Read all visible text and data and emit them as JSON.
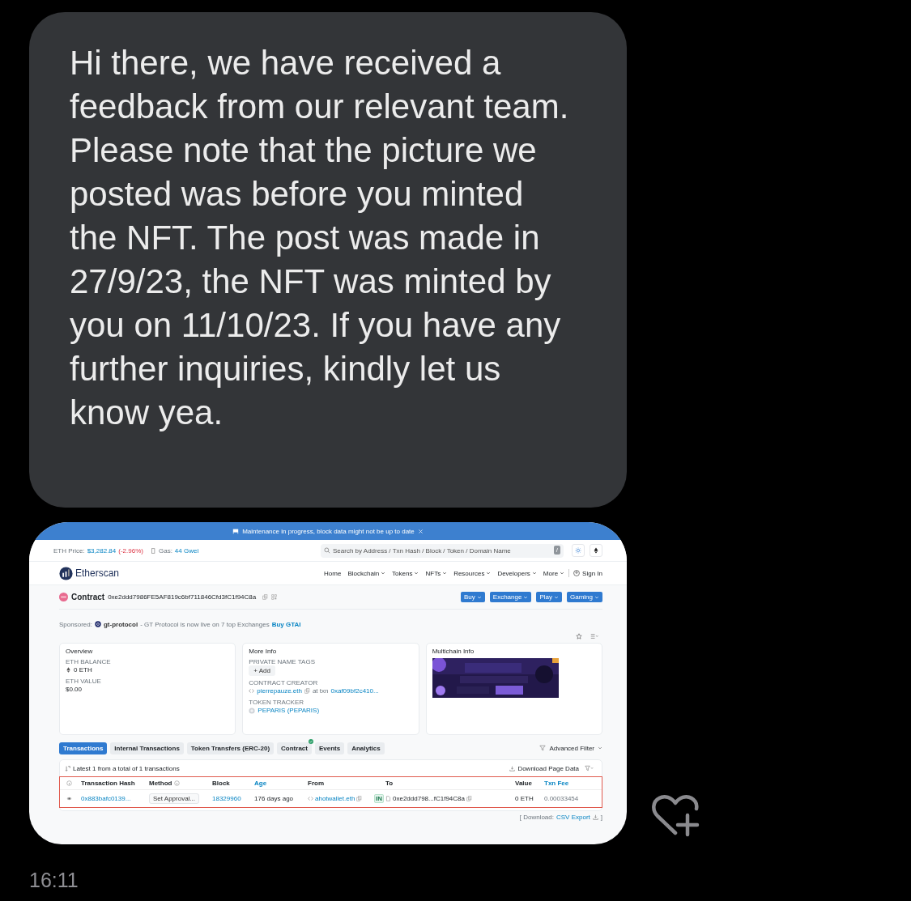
{
  "message": {
    "text": "Hi there, we have received a feedback from our relevant team. Please note that the picture we posted was before you minted the NFT. The post was made in 27/9/23, the NFT was minted by you on 11/10/23. If you have any further inquiries, kindly let us know yea."
  },
  "attachment": {
    "banner": {
      "text": "Maintenance in progress, block data might not be up to date"
    },
    "topbar": {
      "eth_price_label": "ETH Price:",
      "eth_price": "$3,282.84",
      "eth_change": "(-2.96%)",
      "gas_label": "Gas:",
      "gas": "44 Gwei",
      "search_placeholder": "Search by Address / Txn Hash / Block / Token / Domain Name",
      "shortcut": "/"
    },
    "nav": {
      "brand": "Etherscan",
      "items": [
        {
          "label": "Home",
          "dropdown": false
        },
        {
          "label": "Blockchain",
          "dropdown": true
        },
        {
          "label": "Tokens",
          "dropdown": true
        },
        {
          "label": "NFTs",
          "dropdown": true
        },
        {
          "label": "Resources",
          "dropdown": true
        },
        {
          "label": "Developers",
          "dropdown": true
        },
        {
          "label": "More",
          "dropdown": true
        }
      ],
      "sign_in": "Sign In"
    },
    "contract": {
      "label": "Contract",
      "address": "0xe2ddd7986FE5AF819c6bf711846Cfd3fC1f94C8a",
      "buttons": [
        "Buy",
        "Exchange",
        "Play",
        "Gaming"
      ]
    },
    "sponsored": {
      "label": "Sponsored:",
      "name": "gt-protocol",
      "text": "- GT Protocol is now live on 7 top Exchanges",
      "link": "Buy GTAI"
    },
    "overview": {
      "title": "Overview",
      "fields": [
        {
          "label": "ETH BALANCE",
          "value": "0 ETH",
          "eth": true
        },
        {
          "label": "ETH VALUE",
          "value": "$0.00",
          "eth": false
        }
      ]
    },
    "more_info": {
      "title": "More Info",
      "name_tags_label": "PRIVATE NAME TAGS",
      "add": "+ Add",
      "creator_label": "CONTRACT CREATOR",
      "creator": "pierrepauze.eth",
      "at_txn": "at txn",
      "txn": "0xaf09bf2c410...",
      "tracker_label": "TOKEN TRACKER",
      "token": "PEPARIS (PEPARIS)"
    },
    "multichain": {
      "title": "Multichain Info"
    },
    "tabs": [
      {
        "label": "Transactions",
        "selected": true,
        "verified": false
      },
      {
        "label": "Internal Transactions",
        "selected": false,
        "verified": false
      },
      {
        "label": "Token Transfers (ERC-20)",
        "selected": false,
        "verified": false
      },
      {
        "label": "Contract",
        "selected": false,
        "verified": true
      },
      {
        "label": "Events",
        "selected": false,
        "verified": false
      },
      {
        "label": "Analytics",
        "selected": false,
        "verified": false
      }
    ],
    "advanced_filter": "Advanced Filter",
    "table": {
      "summary": "Latest 1 from a total of 1 transactions",
      "download": "Download Page Data",
      "columns": [
        {
          "label": "Transaction Hash",
          "link": false,
          "info": false
        },
        {
          "label": "Method",
          "link": false,
          "info": true
        },
        {
          "label": "Block",
          "link": false,
          "info": false
        },
        {
          "label": "Age",
          "link": true,
          "info": false
        },
        {
          "label": "From",
          "link": false,
          "info": false
        },
        {
          "label": "To",
          "link": false,
          "info": false
        },
        {
          "label": "Value",
          "link": false,
          "info": false
        },
        {
          "label": "Txn Fee",
          "link": true,
          "info": false
        }
      ],
      "rows": [
        {
          "hash": "0x883bafc0139...",
          "method": "Set Approval...",
          "block": "18329960",
          "age": "176 days ago",
          "from": "ahotwallet.eth",
          "direction": "IN",
          "to": "0xe2ddd798...fC1f94C8a",
          "value": "0 ETH",
          "fee": "0.00033454"
        }
      ]
    },
    "csv": {
      "prefix": "[ Download:",
      "link": "CSV Export",
      "suffix": "]"
    }
  },
  "time": "16:11"
}
